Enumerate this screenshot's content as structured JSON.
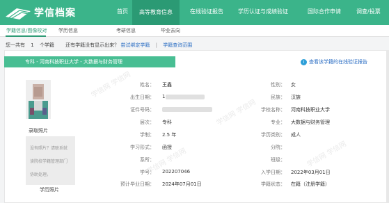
{
  "logo": {
    "text": "学信档案",
    "icon": "book-logo-icon"
  },
  "nav": [
    {
      "label": "首页"
    },
    {
      "label": "高等教育信息"
    },
    {
      "label": "在线验证报告"
    },
    {
      "label": "学历认证与成绩验证"
    },
    {
      "label": "国际合作申请"
    },
    {
      "label": "调查/投票"
    }
  ],
  "subnav": [
    {
      "label": "学籍信息/图像校对"
    },
    {
      "label": "学历信息"
    },
    {
      "label": "考研信息"
    },
    {
      "label": "毕业去向"
    }
  ],
  "notice": {
    "prefix": "您一共有",
    "count": "1",
    "mid": "个学籍",
    "question": "还有学籍没有显示出来？",
    "link1": "尝试绑定学籍",
    "separator": "|",
    "link2": "学籍查询范围"
  },
  "banner": {
    "text": "专科 - 河南科技职业大学 - 大数据与财务管理"
  },
  "verify_link": {
    "text": "查看该学籍的在线验证报告",
    "icon": "info-icon"
  },
  "photos": {
    "enroll_caption": "录取照片",
    "edu_caption": "学历照片",
    "edu_placeholder": "没有照片？请联系就读院校学籍管理部门协助处理。"
  },
  "fields": {
    "name_label": "姓名：",
    "name": "王鑫",
    "gender_label": "性别：",
    "gender": "女",
    "birth_label": "出生日期：",
    "birth": "1",
    "ethnic_label": "民族：",
    "ethnic": "汉族",
    "id_label": "证件号码：",
    "school_label": "学校名称：",
    "school": "河南科技职业大学",
    "level_label": "层次：",
    "level": "专科",
    "major_label": "专业：",
    "major": "大数据与财务管理",
    "duration_label": "学制：",
    "duration": "2.5 年",
    "category_label": "学历类别：",
    "category": "成人",
    "form_label": "学习形式：",
    "form": "函授",
    "branch_label": "分院：",
    "department_label": "系所：",
    "class_label": "班级：",
    "student_no_label": "学号：",
    "student_no": "202207046",
    "enroll_date_label": "入学日期：",
    "enroll_date": "2022年03月01日",
    "grad_date_label": "预计毕业日期：",
    "grad_date": "2024年07月01日",
    "status_label": "学籍状态：",
    "status": "在籍（注册学籍）"
  },
  "colors": {
    "primary": "#3bb48a",
    "banner": "#48be93",
    "link": "#2d6fc4"
  }
}
